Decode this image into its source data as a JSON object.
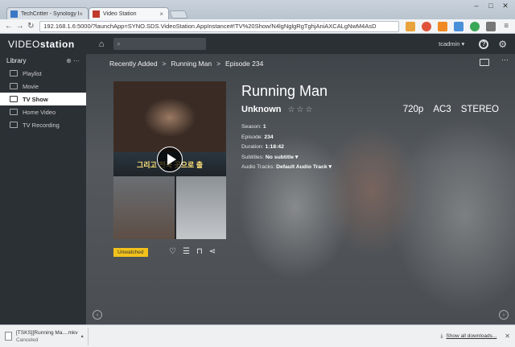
{
  "browser": {
    "tabs": [
      {
        "title": "TechCritter - Synology D",
        "favicon_color": "#3b78c4"
      },
      {
        "title": "Video Station",
        "favicon_color": "#c0392b"
      }
    ],
    "url": "192.168.1.6:5000/?launchApp=SYNO.SDS.VideoStation.AppInstance#!TV%20Show/N4lgNglgRgTghjAniAXCALgNwM4AsD"
  },
  "app": {
    "logo_light": "VIDEO",
    "logo_bold": "station",
    "user": "tcadmin ▾"
  },
  "sidebar": {
    "header": "Library",
    "items": [
      {
        "label": "Playlist",
        "active": false
      },
      {
        "label": "Movie",
        "active": false
      },
      {
        "label": "TV Show",
        "active": true
      },
      {
        "label": "Home Video",
        "active": false
      },
      {
        "label": "TV Recording",
        "active": false
      }
    ]
  },
  "breadcrumb": {
    "items": [
      "Recently Added",
      "Running Man",
      "Episode 234"
    ],
    "separator": ">"
  },
  "video": {
    "title": "Running Man",
    "subtitle": "Unknown",
    "rating": 0,
    "resolution": "720p",
    "audio_codec": "AC3",
    "audio_channels": "STEREO",
    "badge": "Unwatched",
    "poster_caption": "그리고 전국 곳으로 출",
    "meta": {
      "season_label": "Season:",
      "season": "1",
      "episode_label": "Episode:",
      "episode": "234",
      "duration_label": "Duration:",
      "duration": "1:18:42",
      "subtitles_label": "Subtitles:",
      "subtitles": "No subtitle ▾",
      "audio_label": "Audio Tracks:",
      "audio": "Default Audio Track ▾"
    }
  },
  "downloads": {
    "file": "[TSKS][Running Ma....mkv",
    "status": "Canceled",
    "show_all": "Show all downloads..."
  }
}
